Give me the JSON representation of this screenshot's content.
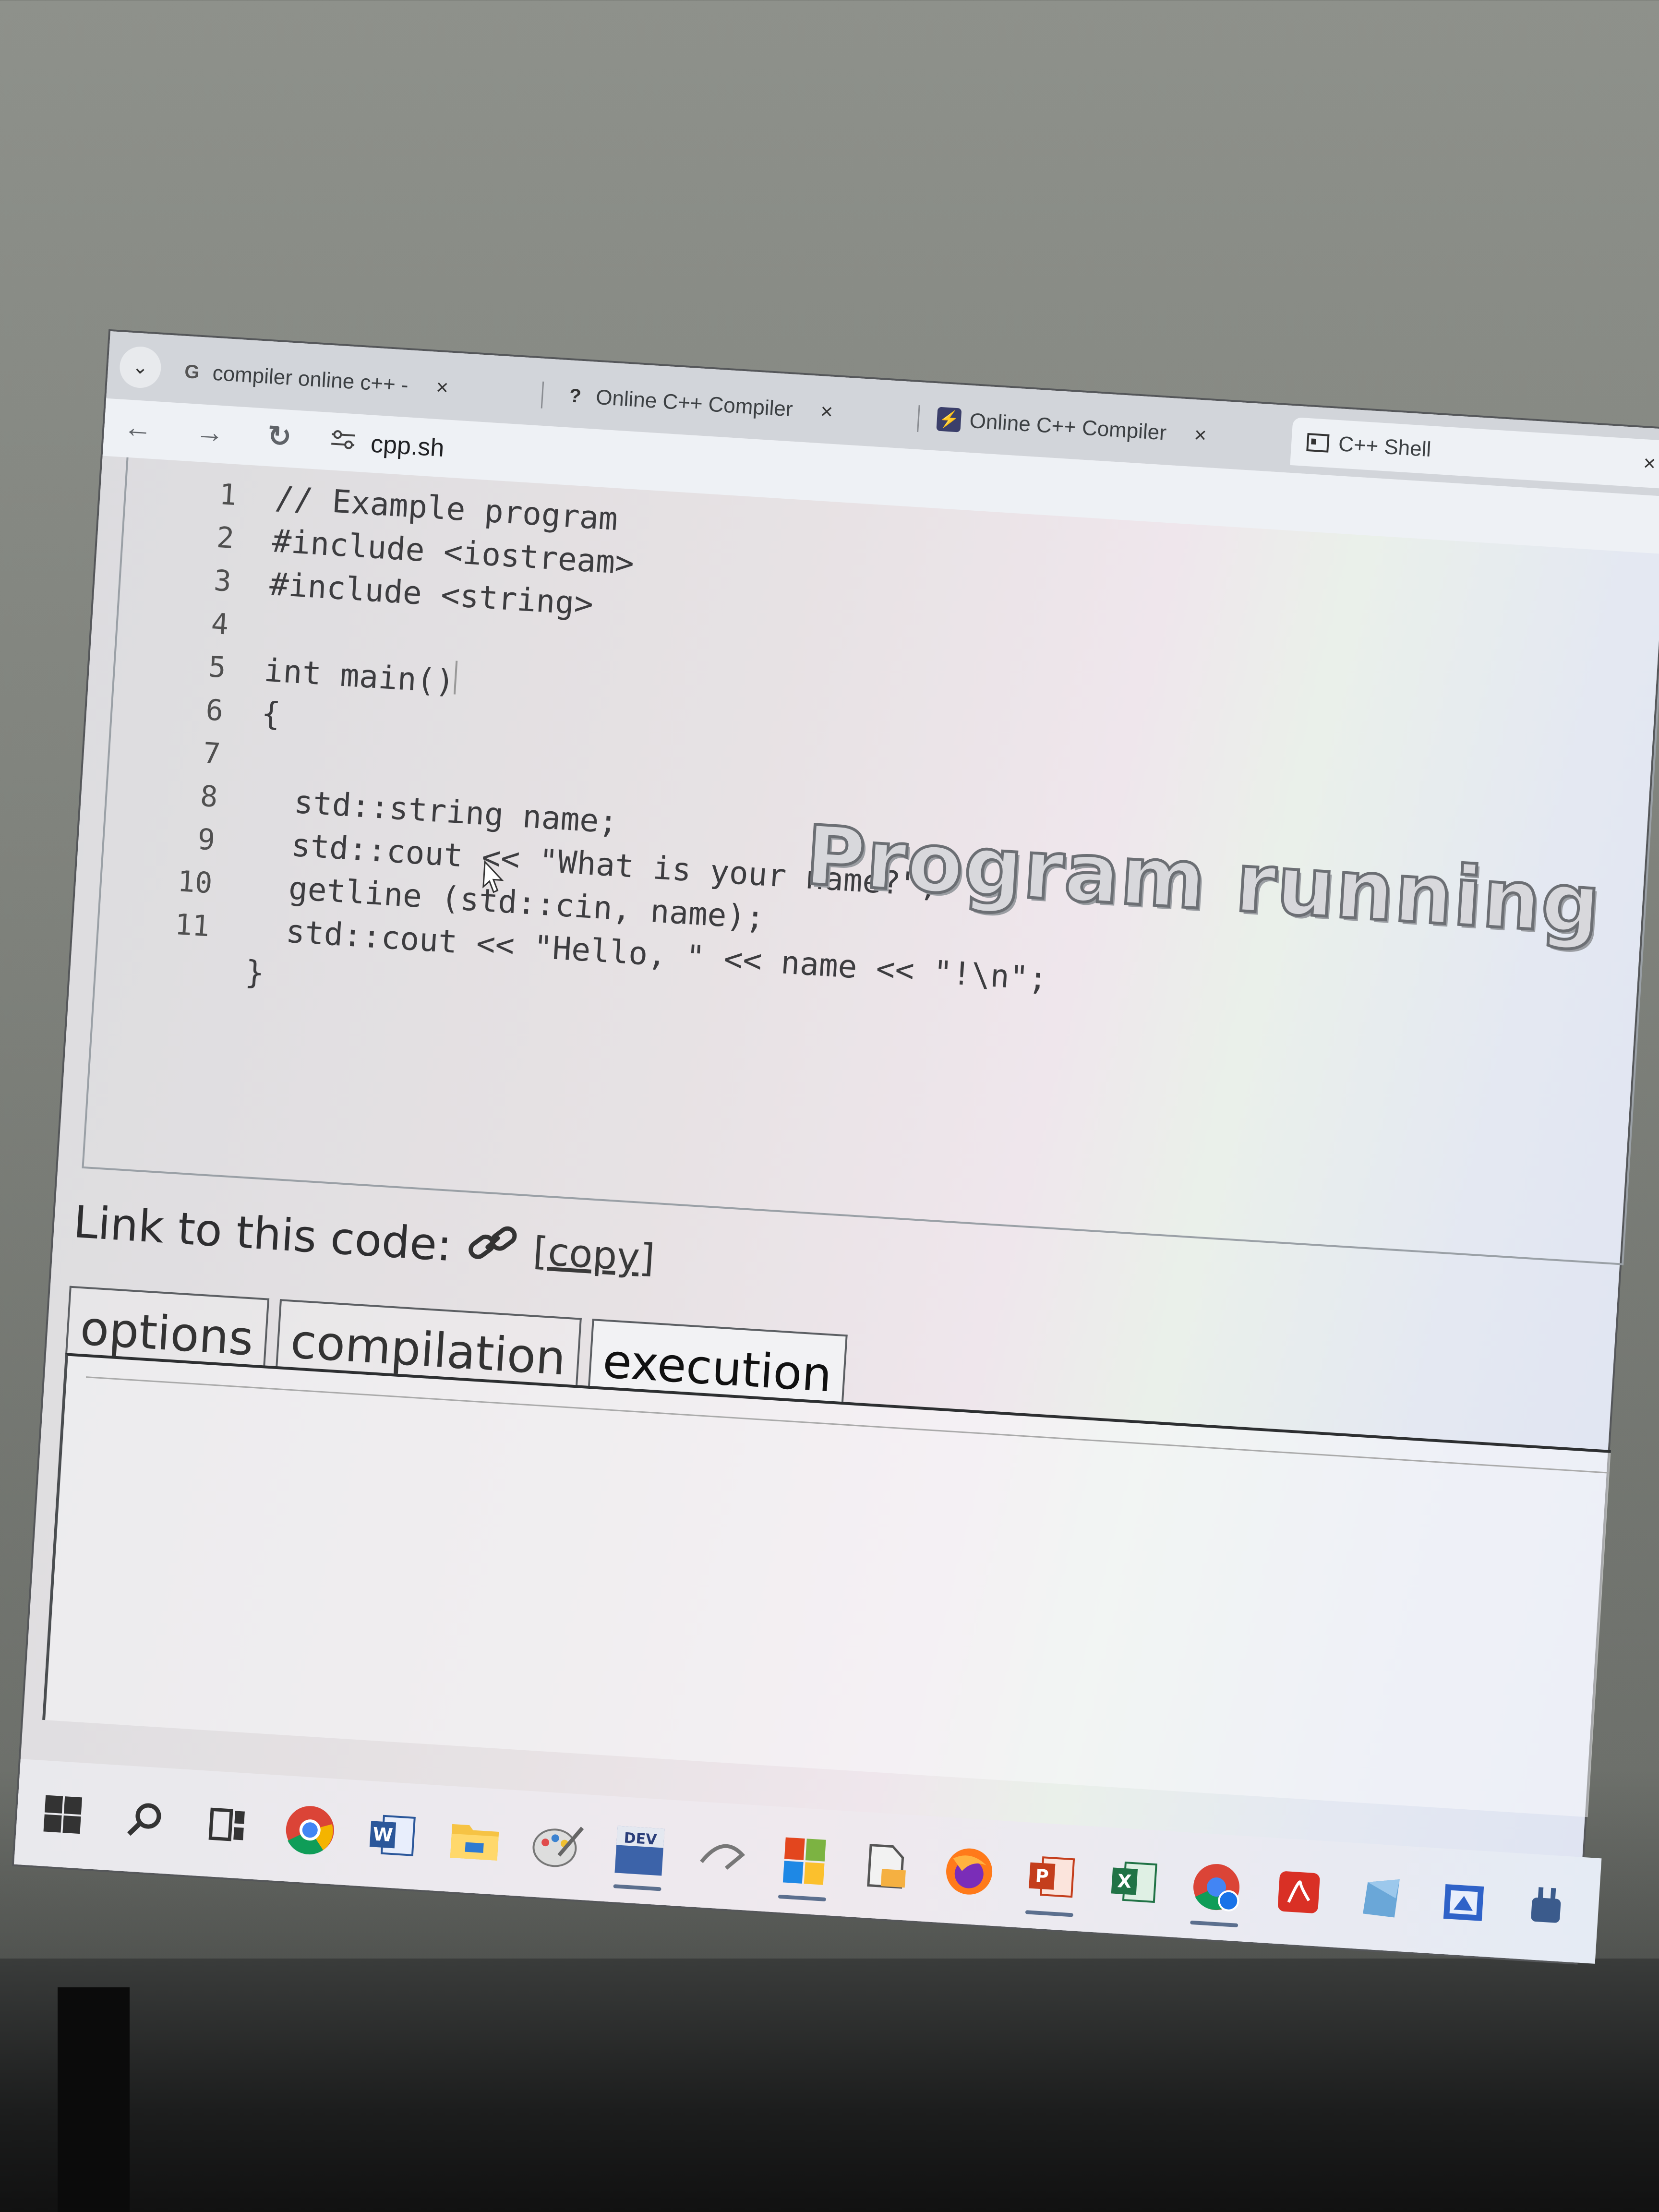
{
  "browser": {
    "tabs": [
      {
        "label": "compiler online c++ -",
        "icon": "google-icon",
        "active": false
      },
      {
        "label": "Online C++ Compiler",
        "icon": "programiz-icon",
        "active": false
      },
      {
        "label": "Online C++ Compiler",
        "icon": "lightning-icon",
        "active": false
      },
      {
        "label": "C++ Shell",
        "icon": "window-icon",
        "active": true
      }
    ],
    "close_glyph": "×",
    "url": "cpp.sh"
  },
  "editor": {
    "lines": [
      {
        "n": "1",
        "code": "// Example program"
      },
      {
        "n": "2",
        "code": "#include <iostream>"
      },
      {
        "n": "3",
        "code": "#include <string>"
      },
      {
        "n": "4",
        "code": ""
      },
      {
        "n": "5",
        "code": "int main()"
      },
      {
        "n": "6",
        "code": "{"
      },
      {
        "n": "7",
        "code": ""
      },
      {
        "n": "8",
        "code": "  std::string name;"
      },
      {
        "n": "9",
        "code": "  std::cout << \"What is your name?\";"
      },
      {
        "n": "10",
        "code": "  getline (std::cin, name);"
      },
      {
        "n": "11",
        "code": "  std::cout << \"Hello, \" << name << \"!\\n\";"
      },
      {
        "n": "",
        "code": "}"
      }
    ],
    "overlay": "Program running"
  },
  "link": {
    "label": "Link to this code:",
    "copy": "[copy]"
  },
  "panel_tabs": [
    "options",
    "compilation",
    "execution"
  ],
  "taskbar": {
    "apps": [
      "start-icon",
      "search-icon",
      "task-view-icon",
      "chrome-icon",
      "word-icon",
      "file-explorer-icon",
      "paint-icon",
      "dev-cpp-icon",
      "app-arrow-icon",
      "store-icon",
      "file-app-icon",
      "firefox-icon",
      "powerpoint-icon",
      "excel-icon",
      "chrome-profile-icon",
      "acrobat-icon",
      "app-blue-icon",
      "app-window-icon",
      "app-plug-icon"
    ],
    "dev_label": "DEV"
  }
}
